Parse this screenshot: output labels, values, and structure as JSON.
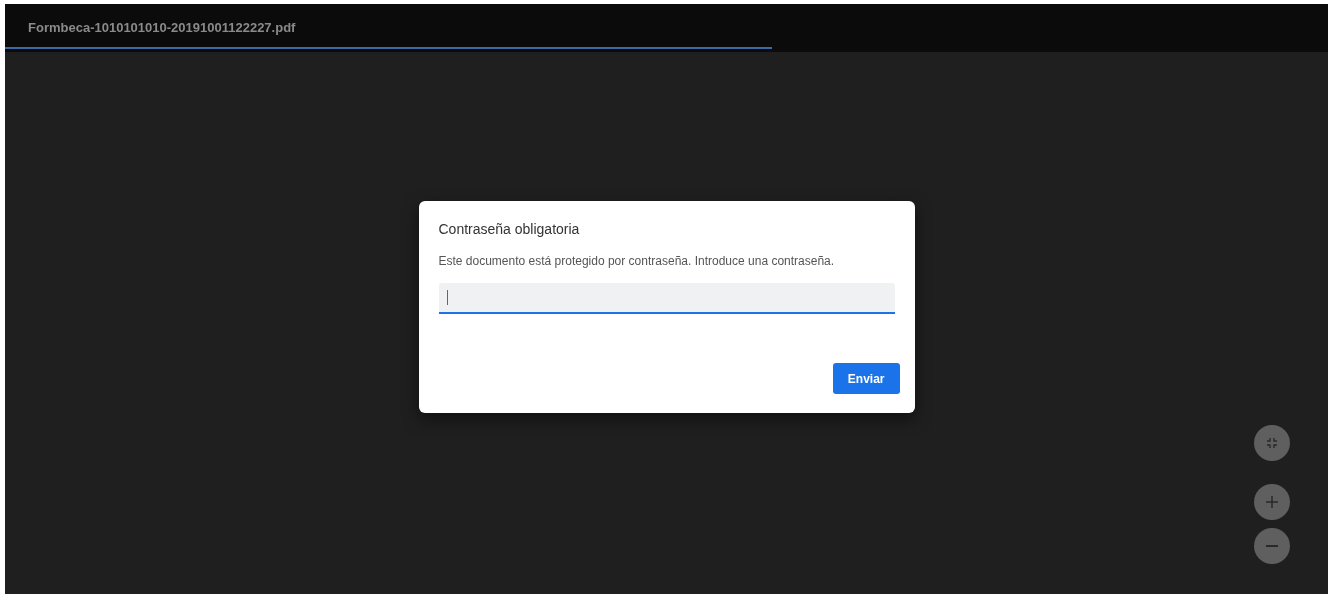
{
  "toolbar": {
    "filename": "Formbeca-1010101010-20191001122227.pdf",
    "progress": {
      "level": 0.58
    }
  },
  "dialog": {
    "title": "Contraseña obligatoria",
    "message": "Este documento está protegido por contraseña. Introduce una contraseña.",
    "password_field": {
      "focused": true
    },
    "submit_button": "Enviar"
  },
  "zoom_controls": [
    {
      "kind": "fit"
    },
    {
      "kind": "zoom-in"
    },
    {
      "kind": "zoom-out"
    }
  ]
}
